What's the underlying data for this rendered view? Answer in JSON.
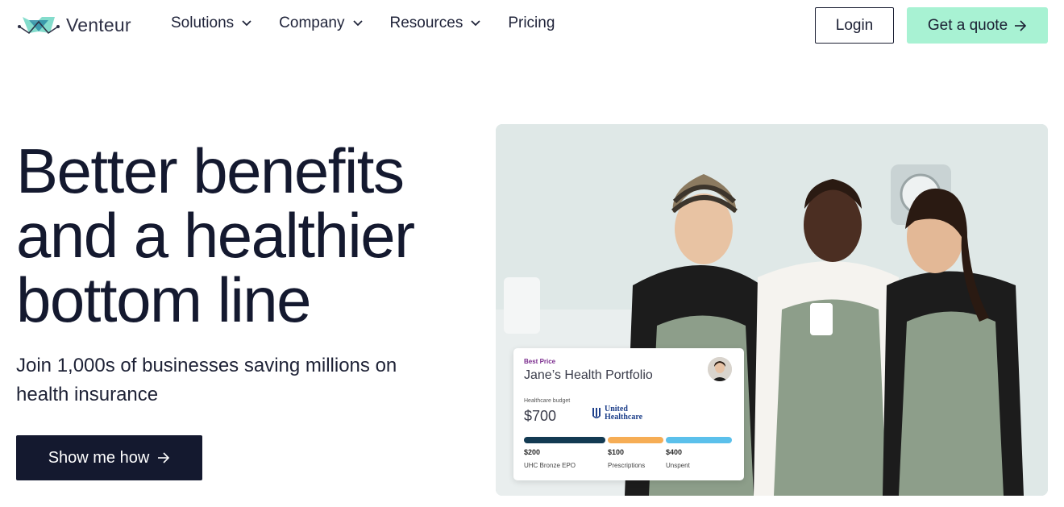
{
  "brand": {
    "name": "Venteur",
    "accent": "#a8f2d3",
    "dark": "#14192f"
  },
  "nav": {
    "items": [
      {
        "label": "Solutions",
        "has_dropdown": true
      },
      {
        "label": "Company",
        "has_dropdown": true
      },
      {
        "label": "Resources",
        "has_dropdown": true
      },
      {
        "label": "Pricing",
        "has_dropdown": false
      }
    ],
    "login_label": "Login",
    "quote_label": "Get a quote"
  },
  "hero": {
    "headline": [
      "Better benefits",
      "and a healthier",
      "bottom line"
    ],
    "subline": "Join 1,000s of businesses saving millions on health insurance",
    "cta_label": "Show me how"
  },
  "card": {
    "tag": "Best Price",
    "title": "Jane’s Health Portfolio",
    "budget_label": "Healthcare budget",
    "budget_value": "$700",
    "insurer": [
      "United",
      "Healthcare"
    ],
    "segments": [
      {
        "value": "$200",
        "label": "UHC Bronze EPO",
        "color": "#133a52"
      },
      {
        "value": "$100",
        "label": "Prescriptions",
        "color": "#f6ad55"
      },
      {
        "value": "$400",
        "label": "Unspent",
        "color": "#5bc0eb"
      }
    ]
  },
  "icons": {
    "chevron": "chevron-down-icon",
    "arrow": "arrow-right-icon",
    "logo": "venteur-logo-icon"
  }
}
